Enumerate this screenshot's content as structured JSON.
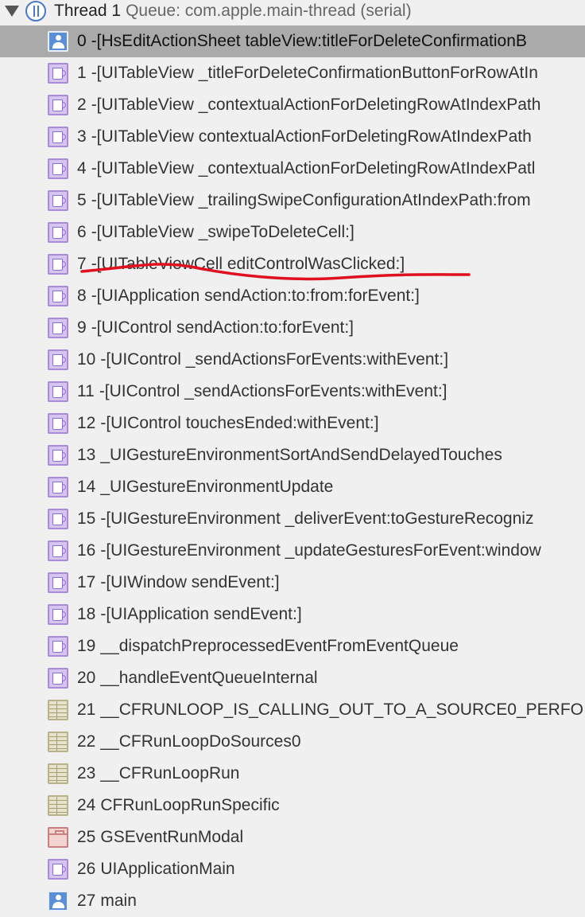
{
  "thread": {
    "name": "Thread 1",
    "queue": "Queue: com.apple.main-thread (serial)"
  },
  "annotation": {
    "color": "#e0101e"
  },
  "frames": [
    {
      "num": "0",
      "symbol": "-[HsEditActionSheet tableView:titleForDeleteConfirmationB",
      "icon": "user-icon"
    },
    {
      "num": "1",
      "symbol": "-[UITableView _titleForDeleteConfirmationButtonForRowAtIn",
      "icon": "framework-icon"
    },
    {
      "num": "2",
      "symbol": "-[UITableView _contextualActionForDeletingRowAtIndexPath",
      "icon": "framework-icon"
    },
    {
      "num": "3",
      "symbol": "-[UITableView contextualActionForDeletingRowAtIndexPath",
      "icon": "framework-icon"
    },
    {
      "num": "4",
      "symbol": "-[UITableView _contextualActionForDeletingRowAtIndexPatl",
      "icon": "framework-icon"
    },
    {
      "num": "5",
      "symbol": "-[UITableView _trailingSwipeConfigurationAtIndexPath:from",
      "icon": "framework-icon"
    },
    {
      "num": "6",
      "symbol": "-[UITableView _swipeToDeleteCell:]",
      "icon": "framework-icon"
    },
    {
      "num": "7",
      "symbol": "-[UITableViewCell editControlWasClicked:]",
      "icon": "framework-icon"
    },
    {
      "num": "8",
      "symbol": "-[UIApplication sendAction:to:from:forEvent:]",
      "icon": "framework-icon"
    },
    {
      "num": "9",
      "symbol": "-[UIControl sendAction:to:forEvent:]",
      "icon": "framework-icon"
    },
    {
      "num": "10",
      "symbol": "-[UIControl _sendActionsForEvents:withEvent:]",
      "icon": "framework-icon"
    },
    {
      "num": "11",
      "symbol": "-[UIControl _sendActionsForEvents:withEvent:]",
      "icon": "framework-icon"
    },
    {
      "num": "12",
      "symbol": "-[UIControl touchesEnded:withEvent:]",
      "icon": "framework-icon"
    },
    {
      "num": "13",
      "symbol": "_UIGestureEnvironmentSortAndSendDelayedTouches",
      "icon": "framework-icon"
    },
    {
      "num": "14",
      "symbol": "_UIGestureEnvironmentUpdate",
      "icon": "framework-icon"
    },
    {
      "num": "15",
      "symbol": "-[UIGestureEnvironment _deliverEvent:toGestureRecogniz",
      "icon": "framework-icon"
    },
    {
      "num": "16",
      "symbol": "-[UIGestureEnvironment _updateGesturesForEvent:window",
      "icon": "framework-icon"
    },
    {
      "num": "17",
      "symbol": "-[UIWindow sendEvent:]",
      "icon": "framework-icon"
    },
    {
      "num": "18",
      "symbol": "-[UIApplication sendEvent:]",
      "icon": "framework-icon"
    },
    {
      "num": "19",
      "symbol": "__dispatchPreprocessedEventFromEventQueue",
      "icon": "framework-icon"
    },
    {
      "num": "20",
      "symbol": "__handleEventQueueInternal",
      "icon": "framework-icon"
    },
    {
      "num": "21",
      "symbol": "__CFRUNLOOP_IS_CALLING_OUT_TO_A_SOURCE0_PERFO",
      "icon": "library-icon"
    },
    {
      "num": "22",
      "symbol": "__CFRunLoopDoSources0",
      "icon": "library-icon"
    },
    {
      "num": "23",
      "symbol": "__CFRunLoopRun",
      "icon": "library-icon"
    },
    {
      "num": "24",
      "symbol": "CFRunLoopRunSpecific",
      "icon": "library-icon"
    },
    {
      "num": "25",
      "symbol": "GSEventRunModal",
      "icon": "system-icon"
    },
    {
      "num": "26",
      "symbol": "UIApplicationMain",
      "icon": "framework-icon"
    },
    {
      "num": "27",
      "symbol": "main",
      "icon": "user-icon"
    }
  ]
}
